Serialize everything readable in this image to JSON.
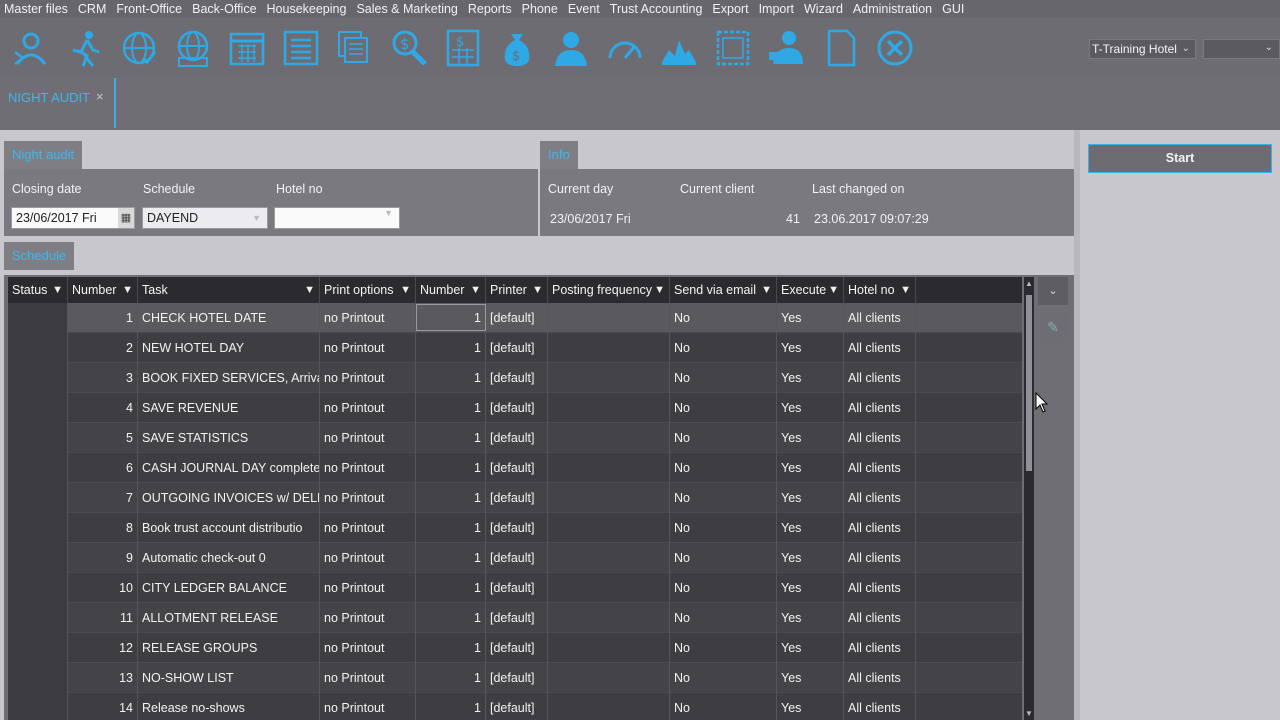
{
  "menu": [
    "Master files",
    "CRM",
    "Front-Office",
    "Back-Office",
    "Housekeeping",
    "Sales & Marketing",
    "Reports",
    "Phone",
    "Event",
    "Trust Accounting",
    "Export",
    "Import",
    "Wizard",
    "Administration",
    "GUI"
  ],
  "toolbar": {
    "icons": [
      "reservation-icon",
      "walk-in-icon",
      "globe-check-icon",
      "globe-grid-icon",
      "calendar-grid-icon",
      "list-icon",
      "documents-icon",
      "search-money-icon",
      "calculator-icon",
      "money-bag-icon",
      "guest-icon",
      "speedometer-icon",
      "hotel-building-icon",
      "floor-plan-icon",
      "staff-icon",
      "blank-page-icon",
      "close-circle-icon"
    ],
    "hotel": "T-Training Hotel",
    "second_value": ""
  },
  "doc_tab": {
    "label": "NIGHT AUDIT",
    "close": "×"
  },
  "night_audit": {
    "tab_label": "Night audit",
    "closing_date_label": "Closing date",
    "schedule_label": "Schedule",
    "hotel_no_label": "Hotel no",
    "closing_date_value": "23/06/2017 Fri",
    "schedule_value": "DAYEND",
    "hotel_no_value": ""
  },
  "info": {
    "tab_label": "Info",
    "current_day_label": "Current day",
    "current_client_label": "Current client",
    "last_changed_label": "Last changed on",
    "current_day_value": "23/06/2017 Fri",
    "current_client_value": "41",
    "last_changed_value": "23.06.2017 09:07:29"
  },
  "start_label": "Start",
  "schedule": {
    "tab_label": "Schedule",
    "columns": [
      "Status",
      "Number",
      "Task",
      "Print options",
      "Number",
      "Printer",
      "Posting frequency",
      "Send via email",
      "Execute",
      "Hotel no"
    ],
    "rows": [
      [
        "",
        "1",
        "CHECK HOTEL DATE",
        "no Printout",
        "1",
        "[default]",
        "",
        "No",
        "Yes",
        "All clients"
      ],
      [
        "",
        "2",
        "NEW HOTEL DAY",
        "no Printout",
        "1",
        "[default]",
        "",
        "No",
        "Yes",
        "All clients"
      ],
      [
        "",
        "3",
        "BOOK FIXED SERVICES, Arrivals",
        "no Printout",
        "1",
        "[default]",
        "",
        "No",
        "Yes",
        "All clients"
      ],
      [
        "",
        "4",
        "SAVE REVENUE",
        "no Printout",
        "1",
        "[default]",
        "",
        "No",
        "Yes",
        "All clients"
      ],
      [
        "",
        "5",
        "SAVE STATISTICS",
        "no Printout",
        "1",
        "[default]",
        "",
        "No",
        "Yes",
        "All clients"
      ],
      [
        "",
        "6",
        "CASH JOURNAL DAY complete",
        "no Printout",
        "1",
        "[default]",
        "",
        "No",
        "Yes",
        "All clients"
      ],
      [
        "",
        "7",
        "OUTGOING INVOICES w/ DELETE",
        "no Printout",
        "1",
        "[default]",
        "",
        "No",
        "Yes",
        "All clients"
      ],
      [
        "",
        "8",
        "Book trust account distributio",
        "no Printout",
        "1",
        "[default]",
        "",
        "No",
        "Yes",
        "All clients"
      ],
      [
        "",
        "9",
        "Automatic check-out 0",
        "no Printout",
        "1",
        "[default]",
        "",
        "No",
        "Yes",
        "All clients"
      ],
      [
        "",
        "10",
        "CITY LEDGER BALANCE",
        "no Printout",
        "1",
        "[default]",
        "",
        "No",
        "Yes",
        "All clients"
      ],
      [
        "",
        "11",
        "ALLOTMENT RELEASE",
        "no Printout",
        "1",
        "[default]",
        "",
        "No",
        "Yes",
        "All clients"
      ],
      [
        "",
        "12",
        "RELEASE GROUPS",
        "no Printout",
        "1",
        "[default]",
        "",
        "No",
        "Yes",
        "All clients"
      ],
      [
        "",
        "13",
        "NO-SHOW LIST",
        "no Printout",
        "1",
        "[default]",
        "",
        "No",
        "Yes",
        "All clients"
      ],
      [
        "",
        "14",
        "Release no-shows",
        "no Printout",
        "1",
        "[default]",
        "",
        "No",
        "Yes",
        "All clients"
      ]
    ]
  },
  "colors": {
    "accent": "#3fb6ef",
    "grid_bg": "#2b2b2f",
    "panel_bg": "#7a7980"
  }
}
